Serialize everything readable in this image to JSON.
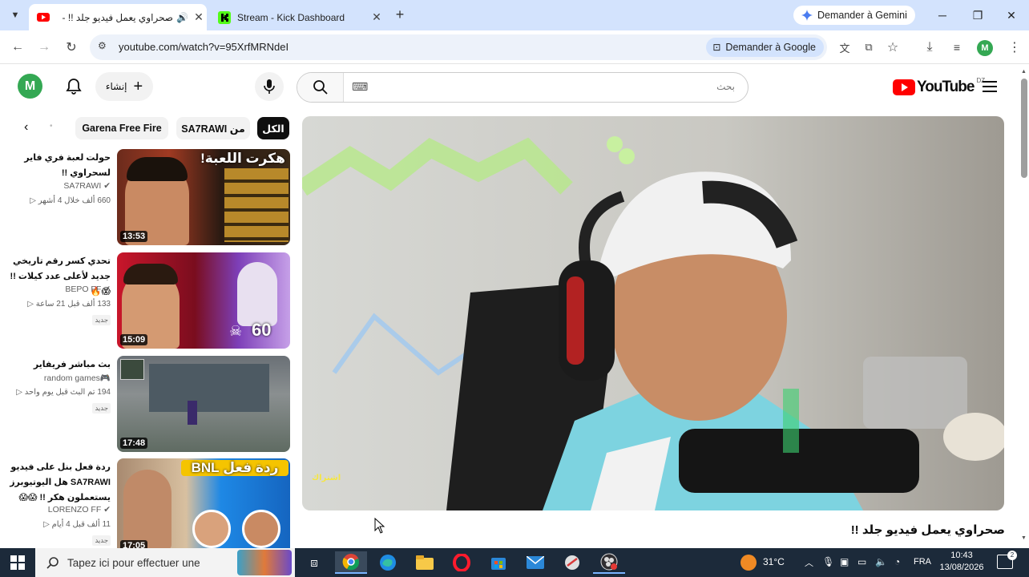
{
  "browser": {
    "tabs": [
      {
        "title": "صحراوي يعمل فيديو جلد !! -",
        "active": true
      },
      {
        "title": "Stream - Kick Dashboard",
        "active": false
      }
    ],
    "new_tab": "+",
    "gemini_label": "Demander à Gemini",
    "url": "youtube.com/watch?v=95XrfMRNdeI",
    "ask_google": "Demander à Google",
    "profile_initial": "M"
  },
  "youtube": {
    "logo_text": "YouTube",
    "region": "DZ",
    "search_placeholder": "بحث",
    "create_label": "إنشاء",
    "avatar_initial": "M",
    "chips": [
      {
        "label": "الكل",
        "selected": true
      },
      {
        "label": "من SA7RAWI",
        "selected": false
      },
      {
        "label": "Garena Free Fire",
        "selected": false
      }
    ],
    "recommendations": [
      {
        "title": "حولت لعبة فري فاير لسحراوي !!",
        "channel": "SA7RAWI",
        "meta": "660 ألف  خلال 4 أشهر",
        "duration": "13:53",
        "badge": "",
        "thumb_text": "هكرت اللعبة!"
      },
      {
        "title": "تحدي كسر رقم تاريخي جديد لأعلى عدد كيلات !! 😱🔥",
        "channel": "BEPO FF",
        "meta": "133 ألف  قبل 21 ساعة",
        "duration": "15:09",
        "badge": "جديد",
        "thumb_text": "60"
      },
      {
        "title": "بث مباشر فريفاير",
        "channel": "random games🎮",
        "meta": "194  تم البث قبل يوم واحد",
        "duration": "17:48",
        "badge": "جديد",
        "thumb_text": ""
      },
      {
        "title": "ردة فعل بنل على فيديو SA7RAWI هل اليوتيوبرز يستعملون هكر !! 😱😱",
        "channel": "LORENZO FF",
        "meta": "11 ألف  قبل 4 أيام",
        "duration": "17:05",
        "badge": "جديد",
        "thumb_text": "ردة فعل BNL"
      }
    ],
    "video": {
      "title": "صحراوي يعمل فيديو جلد !!",
      "watermark": "اشتراك"
    }
  },
  "taskbar": {
    "search_placeholder": "Tapez ici pour effectuer une",
    "temperature": "31°C",
    "language": "FRA",
    "time": "10:43",
    "date": "13/08/2026"
  },
  "colors": {
    "tabbar": "#d3e3fd",
    "youtube_red": "#ff0000",
    "taskbar": "#1c2a3a",
    "avatar_green": "#34a853"
  }
}
